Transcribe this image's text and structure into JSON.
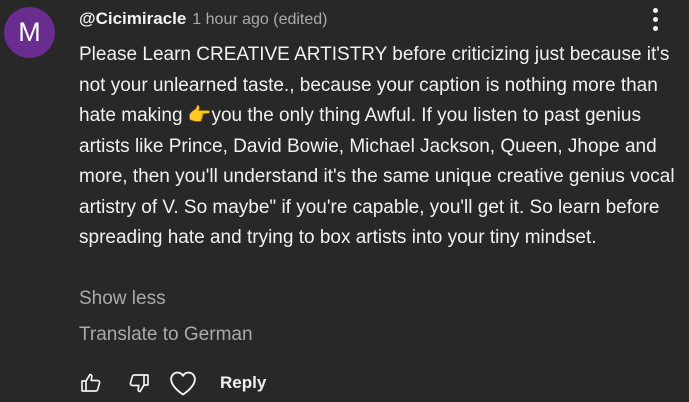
{
  "comment": {
    "avatar_letter": "M",
    "avatar_color": "#6a2c8f",
    "author": "@Cicimiracle",
    "meta": "1 hour ago (edited)",
    "text": "Please Learn CREATIVE ARTISTRY before criticizing just because it's not your unlearned taste., because your caption is nothing more than  hate making 👉you the only thing Awful.  If you listen to past genius artists like Prince, David Bowie, Michael Jackson, Queen, Jhope and more, then you'll understand it's the same unique creative genius vocal artistry of V.  So maybe\" if you're capable, you'll get it. So learn before spreading hate and trying to box artists into your tiny mindset.",
    "show_less_label": "Show less",
    "translate_label": "Translate to German"
  },
  "actions": {
    "reply_label": "Reply",
    "icons": [
      "thumbs-up-icon",
      "thumbs-down-icon",
      "heart-icon"
    ]
  },
  "colors": {
    "background": "#282828",
    "text_primary": "#f1f1f1",
    "text_secondary": "#aaaaaa"
  }
}
